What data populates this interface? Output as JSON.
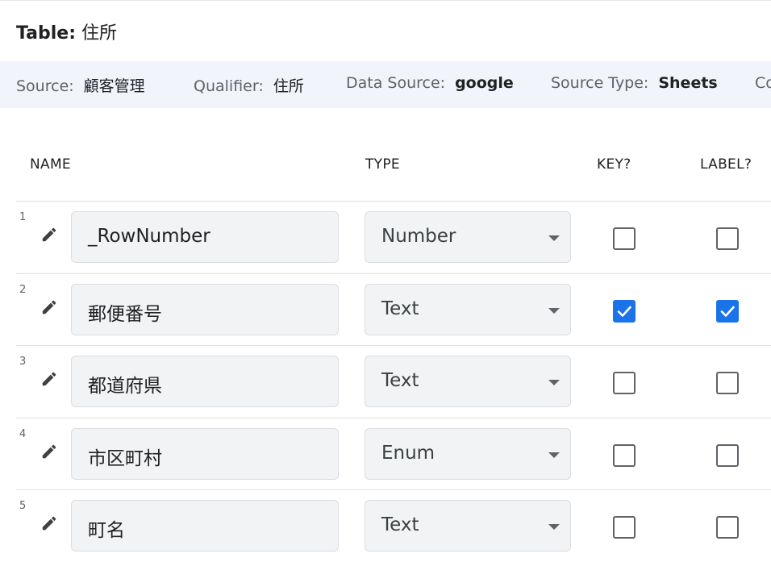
{
  "header": {
    "title_label": "Table:",
    "title_value": "住所"
  },
  "source_bar": {
    "items": [
      {
        "key": "Source:",
        "value": "顧客管理",
        "bold": false
      },
      {
        "key": "Qualifier:",
        "value": "住所",
        "bold": false
      },
      {
        "key": "Data Source:",
        "value": "google",
        "bold": true
      },
      {
        "key": "Source Type:",
        "value": "Sheets",
        "bold": true
      },
      {
        "key": "Co",
        "value": "",
        "bold": false
      }
    ]
  },
  "columns": {
    "name": "NAME",
    "type": "TYPE",
    "key": "KEY?",
    "label": "LABEL?"
  },
  "rows": [
    {
      "num": "1",
      "name": "_RowNumber",
      "type": "Number",
      "key": false,
      "label": false
    },
    {
      "num": "2",
      "name": "郵便番号",
      "type": "Text",
      "key": true,
      "label": true
    },
    {
      "num": "3",
      "name": "都道府県",
      "type": "Text",
      "key": false,
      "label": false
    },
    {
      "num": "4",
      "name": "市区町村",
      "type": "Enum",
      "key": false,
      "label": false
    },
    {
      "num": "5",
      "name": "町名",
      "type": "Text",
      "key": false,
      "label": false
    }
  ],
  "icons": {
    "edit": "pencil-icon",
    "dropdown": "chevron-down-icon",
    "check": "check-icon"
  },
  "colors": {
    "accent": "#1a73e8",
    "source_bar_bg": "#f1f4fb",
    "field_bg": "#f1f3f4"
  }
}
